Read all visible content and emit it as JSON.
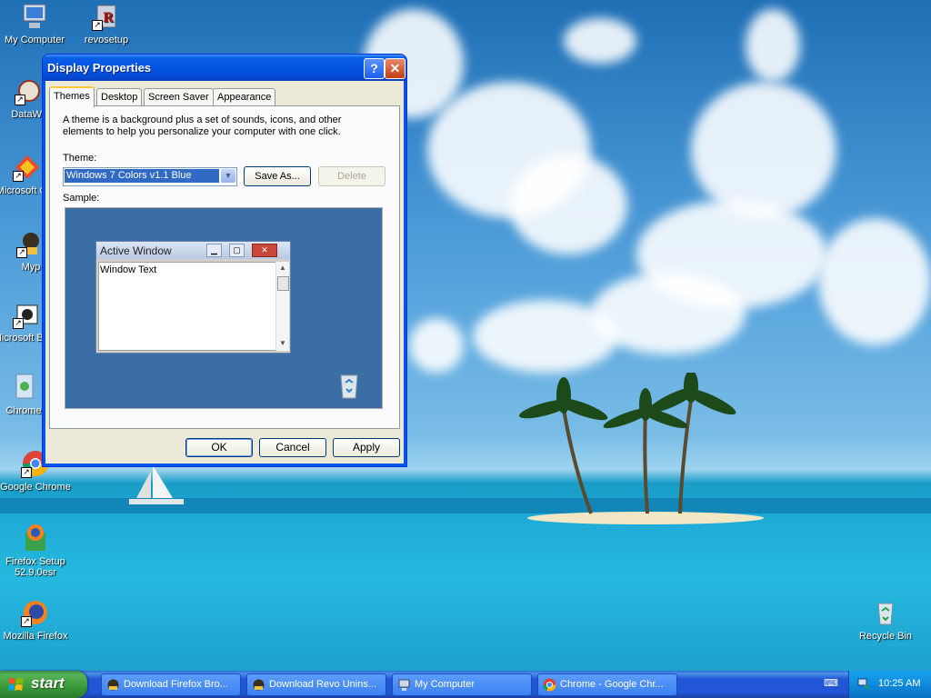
{
  "desktop": {
    "icons": [
      {
        "label": "My Computer"
      },
      {
        "label": "revosetup"
      },
      {
        "label": "DataWa"
      },
      {
        "label": "Microsoft C++"
      },
      {
        "label": "Myp"
      },
      {
        "label": "Microsoft Basic"
      },
      {
        "label": "Chrome"
      },
      {
        "label": "Google Chrome"
      },
      {
        "label": "Firefox Setup 52.9.0esr"
      },
      {
        "label": "Mozilla Firefox"
      },
      {
        "label": "Recycle Bin"
      }
    ]
  },
  "dialog": {
    "title": "Display Properties",
    "help_glyph": "?",
    "close_glyph": "✕",
    "tabs": [
      {
        "label": "Themes",
        "active": true
      },
      {
        "label": "Desktop"
      },
      {
        "label": "Screen Saver"
      },
      {
        "label": "Appearance"
      }
    ],
    "description": "A theme is a background plus a set of sounds, icons, and other elements to help you personalize your computer with one click.",
    "theme_label": "Theme:",
    "theme_value": "Windows 7 Colors v1.1 Blue",
    "save_as_label": "Save As...",
    "delete_label": "Delete",
    "sample_label": "Sample:",
    "sample": {
      "window_title": "Active Window",
      "window_text": "Window Text"
    },
    "ok_label": "OK",
    "cancel_label": "Cancel",
    "apply_label": "Apply"
  },
  "taskbar": {
    "start_label": "start",
    "items": [
      {
        "label": "Download Firefox Bro..."
      },
      {
        "label": "Download Revo Unins..."
      },
      {
        "label": "My Computer"
      },
      {
        "label": "Chrome - Google Chr..."
      }
    ],
    "clock": "10:25 AM"
  }
}
